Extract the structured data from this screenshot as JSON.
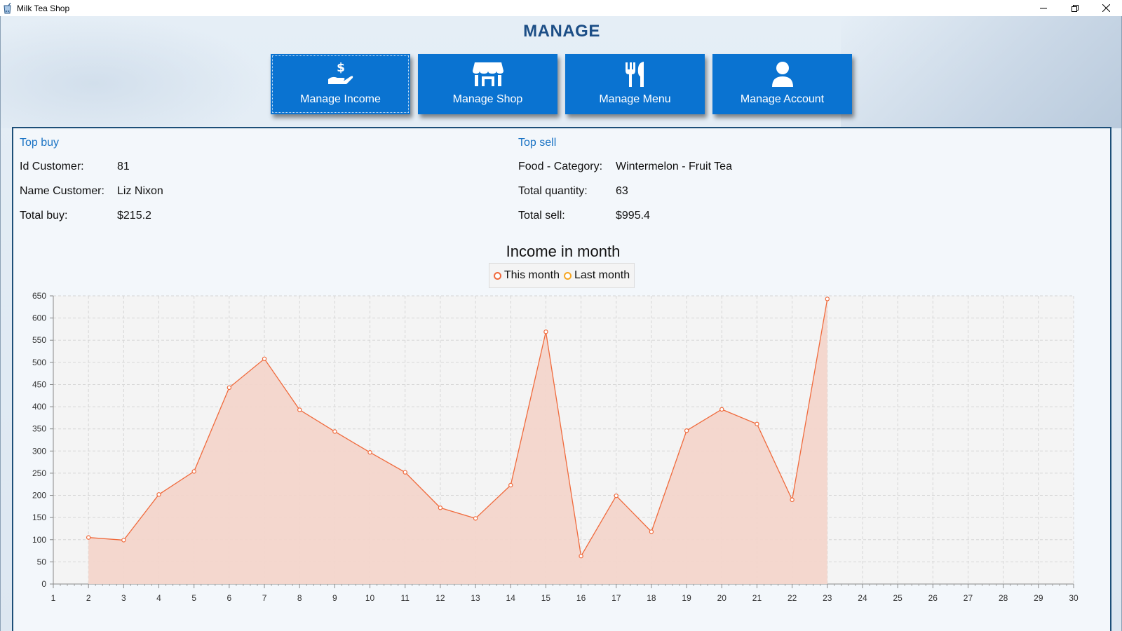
{
  "window": {
    "title": "Milk Tea Shop"
  },
  "header": {
    "title": "MANAGE",
    "nav": [
      {
        "label": "Manage Income",
        "icon": "hand-dollar-icon"
      },
      {
        "label": "Manage Shop",
        "icon": "store-icon"
      },
      {
        "label": "Manage Menu",
        "icon": "fork-knife-icon"
      },
      {
        "label": "Manage Account",
        "icon": "user-icon"
      }
    ]
  },
  "top_buy": {
    "title": "Top buy",
    "id_label": "Id Customer:",
    "id_value": "81",
    "name_label": "Name Customer:",
    "name_value": "Liz Nixon",
    "total_label": "Total buy:",
    "total_value": "$215.2"
  },
  "top_sell": {
    "title": "Top sell",
    "food_label": "Food - Category:",
    "food_value": "Wintermelon - Fruit Tea",
    "qty_label": "Total quantity:",
    "qty_value": "63",
    "total_label": "Total sell:",
    "total_value": "$995.4"
  },
  "colors": {
    "accent": "#0a73d1",
    "this_month": "#f06a3c",
    "last_month": "#f5a623",
    "fill": "#f3d5cb"
  },
  "chart_data": {
    "type": "area",
    "title": "Income in month",
    "xlabel": "",
    "ylabel": "",
    "legend_position": "top-center",
    "grid": true,
    "xlim": [
      1,
      30
    ],
    "ylim": [
      0,
      650
    ],
    "x_ticks": [
      1,
      2,
      3,
      4,
      5,
      6,
      7,
      8,
      9,
      10,
      11,
      12,
      13,
      14,
      15,
      16,
      17,
      18,
      19,
      20,
      21,
      22,
      23,
      24,
      25,
      26,
      27,
      28,
      29,
      30
    ],
    "y_ticks": [
      0,
      50,
      100,
      150,
      200,
      250,
      300,
      350,
      400,
      450,
      500,
      550,
      600,
      650
    ],
    "series": [
      {
        "name": "This month",
        "x": [
          2,
          3,
          4,
          5,
          6,
          7,
          8,
          9,
          10,
          11,
          12,
          13,
          14,
          15,
          16,
          17,
          18,
          19,
          20,
          21,
          22,
          23
        ],
        "values": [
          105,
          99,
          202,
          254,
          443,
          508,
          393,
          344,
          297,
          252,
          172,
          148,
          223,
          569,
          63,
          199,
          118,
          346,
          394,
          361,
          190,
          643
        ]
      },
      {
        "name": "Last month",
        "x": [],
        "values": []
      }
    ]
  }
}
